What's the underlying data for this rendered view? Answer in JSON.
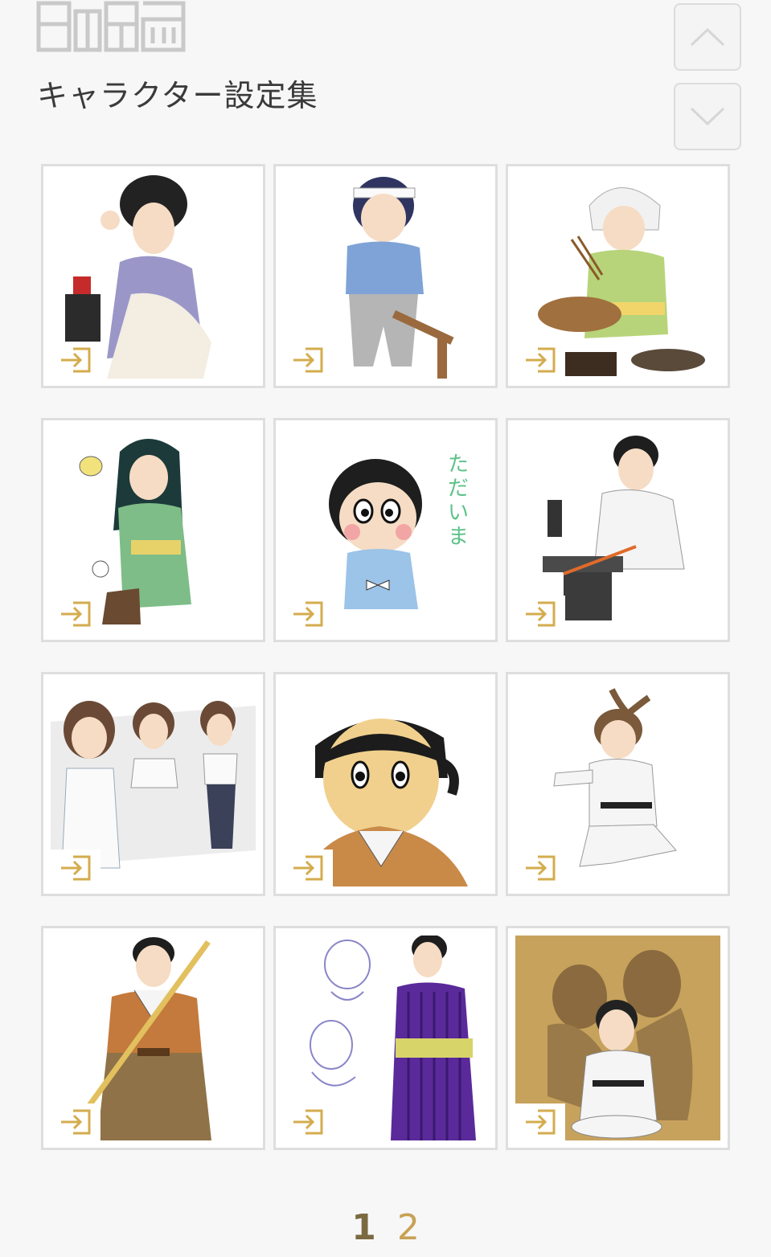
{
  "header": {
    "logo_icon": "brand-logo",
    "title": "キャラクター設定集"
  },
  "controls": {
    "scroll_up_icon": "chevron-up-icon",
    "scroll_down_icon": "chevron-down-icon"
  },
  "gallery": {
    "items": [
      {
        "name": "woman-lavender-kimono-sewing",
        "link_icon": "enter-icon"
      },
      {
        "name": "boy-headband-blue-kimono-with-hoe",
        "link_icon": "enter-icon"
      },
      {
        "name": "woman-headscarf-green-kimono-cooking",
        "link_icon": "enter-icon"
      },
      {
        "name": "woman-green-kimono-with-flower",
        "link_icon": "enter-icon"
      },
      {
        "name": "chibi-boy-blue-kimono",
        "link_icon": "enter-icon",
        "caption": "ただいま"
      },
      {
        "name": "blacksmith-man-forging",
        "link_icon": "enter-icon"
      },
      {
        "name": "modern-woman-three-views",
        "link_icon": "enter-icon"
      },
      {
        "name": "boy-face-brown-kimono",
        "link_icon": "enter-icon"
      },
      {
        "name": "martial-artist-white-gi",
        "link_icon": "enter-icon"
      },
      {
        "name": "man-brown-hakama-with-staff",
        "link_icon": "enter-icon"
      },
      {
        "name": "woman-purple-striped-kimono-sketches",
        "link_icon": "enter-icon"
      },
      {
        "name": "seated-man-gi-with-women-silhouettes",
        "link_icon": "enter-icon"
      }
    ]
  },
  "pagination": {
    "pages": [
      "1",
      "2"
    ],
    "current": "1"
  },
  "colors": {
    "accent": "#d4ac4e",
    "pagination": "#c8a155",
    "pagination_current": "#7b6a41",
    "card_border": "#dedede",
    "background": "#f7f7f7"
  }
}
